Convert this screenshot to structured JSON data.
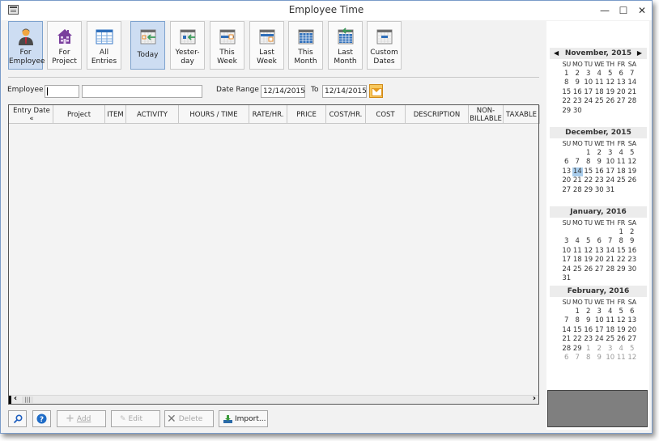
{
  "window": {
    "title": "Employee Time",
    "controls": [
      "minimize",
      "maximize",
      "close"
    ]
  },
  "toolbar": [
    {
      "id": "for-employee",
      "label": "For\nEmployee",
      "icon": "person-icon",
      "active": true
    },
    {
      "id": "for-project",
      "label": "For\nProject",
      "icon": "house-icon",
      "active": false
    },
    {
      "id": "all-entries",
      "label": "All\nEntries",
      "icon": "table-icon",
      "active": false
    },
    {
      "id": "today",
      "label": "Today",
      "icon": "calendar-today-icon",
      "active": true
    },
    {
      "id": "yesterday",
      "label": "Yester-\nday",
      "icon": "calendar-yesterday-icon",
      "active": false
    },
    {
      "id": "this-week",
      "label": "This\nWeek",
      "icon": "calendar-week-icon",
      "active": false
    },
    {
      "id": "last-week",
      "label": "Last\nWeek",
      "icon": "calendar-last-week-icon",
      "active": false
    },
    {
      "id": "this-month",
      "label": "This\nMonth",
      "icon": "calendar-month-icon",
      "active": false
    },
    {
      "id": "last-month",
      "label": "Last\nMonth",
      "icon": "calendar-last-month-icon",
      "active": false
    },
    {
      "id": "custom-dates",
      "label": "Custom\nDates",
      "icon": "calendar-custom-icon",
      "active": false
    }
  ],
  "filters": {
    "employee_label": "Employee",
    "employee_code": "",
    "employee_name": "",
    "date_range_label": "Date Range",
    "date_from": "12/14/2015",
    "to_label": "To",
    "date_to": "12/14/2015"
  },
  "grid": {
    "columns": [
      "Entry Date «",
      "Project",
      "ITEM",
      "ACTIVITY",
      "HOURS / TIME",
      "RATE/HR.",
      "PRICE",
      "COST/HR.",
      "COST",
      "DESCRIPTION",
      "NON-\nBILLABLE",
      "TAXABLE"
    ],
    "rows": []
  },
  "buttons": {
    "search": "search",
    "help": "help",
    "add": "Add",
    "edit": "Edit",
    "delete": "Delete",
    "import": "Import..."
  },
  "calendar": {
    "weekday_headers": [
      "SU",
      "MO",
      "TU",
      "WE",
      "TH",
      "FR",
      "SA"
    ],
    "selected_date": "12/14/2015",
    "months": [
      {
        "title": "November, 2015",
        "lead_blanks": 0,
        "days": 30,
        "trailing": []
      },
      {
        "title": "December, 2015",
        "lead_blanks": 2,
        "days": 31,
        "trailing": []
      },
      {
        "title": "January, 2016",
        "lead_blanks": 5,
        "days": 31,
        "trailing": []
      },
      {
        "title": "February, 2016",
        "lead_blanks": 1,
        "days": 29,
        "trailing": [
          1,
          2,
          3,
          4,
          5,
          6,
          7,
          8,
          9,
          10,
          11,
          12
        ]
      }
    ]
  }
}
